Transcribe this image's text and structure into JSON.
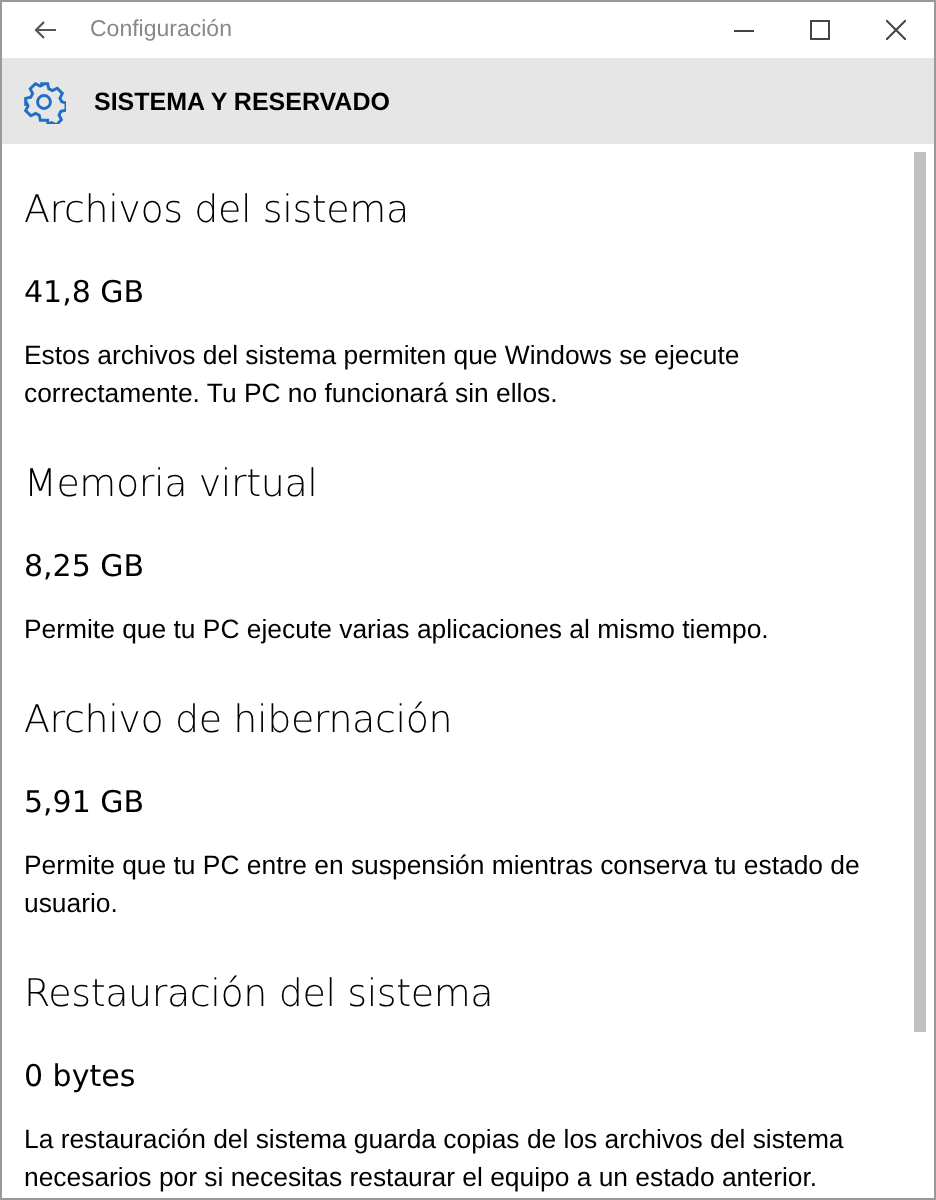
{
  "window": {
    "title": "Configuración"
  },
  "header": {
    "title": "SISTEMA Y RESERVADO"
  },
  "sections": [
    {
      "heading": "Archivos del sistema",
      "size": "41,8 GB",
      "description": "Estos archivos del sistema permiten que Windows se ejecute correctamente. Tu PC no funcionará sin ellos."
    },
    {
      "heading": "Memoria virtual",
      "size": "8,25 GB",
      "description": "Permite que tu PC ejecute varias aplicaciones al mismo tiempo."
    },
    {
      "heading": "Archivo de hibernación",
      "size": "5,91 GB",
      "description": "Permite que tu PC entre en suspensión mientras conserva tu estado de usuario."
    },
    {
      "heading": "Restauración del sistema",
      "size": "0 bytes",
      "description": "La restauración del sistema guarda copias de los archivos del sistema necesarios por si necesitas restaurar el equipo a un estado anterior."
    }
  ]
}
